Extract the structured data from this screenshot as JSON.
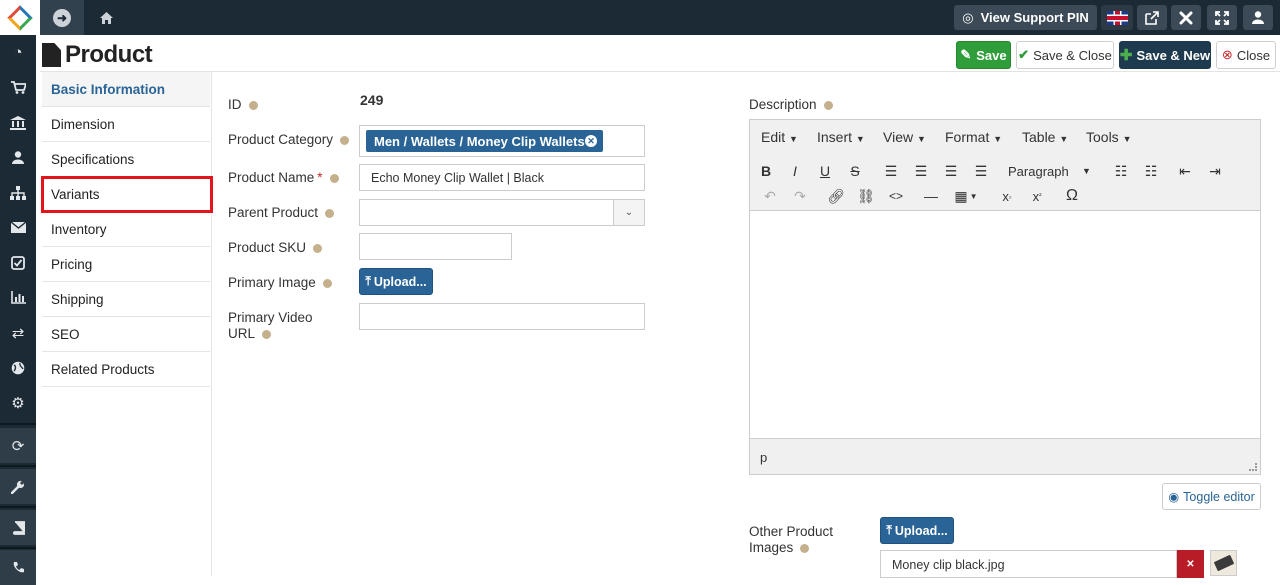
{
  "topbar": {
    "support_label": "View Support PIN"
  },
  "header": {
    "title": "Product",
    "save": "Save",
    "save_close": "Save & Close",
    "save_new": "Save & New",
    "close": "Close"
  },
  "tabs": [
    "Basic Information",
    "Dimension",
    "Specifications",
    "Variants",
    "Inventory",
    "Pricing",
    "Shipping",
    "SEO",
    "Related Products"
  ],
  "form": {
    "id_label": "ID",
    "id_value": "249",
    "category_label": "Product Category",
    "category_tag": "Men / Wallets / Money Clip Wallets",
    "name_label": "Product Name",
    "name_required": "*",
    "name_value": "Echo Money Clip Wallet | Black",
    "parent_label": "Parent Product",
    "sku_label": "Product SKU",
    "image_label": "Primary Image",
    "upload_label": "Upload...",
    "video_label_1": "Primary Video",
    "video_label_2": "URL",
    "description_label": "Description",
    "other_images_label_1": "Other Product",
    "other_images_label_2": "Images",
    "other_upload_label": "Upload...",
    "file_name": "Money clip black.jpg",
    "toggle_editor": "Toggle editor"
  },
  "editor": {
    "menus": [
      "Edit",
      "Insert",
      "View",
      "Format",
      "Table",
      "Tools"
    ],
    "paragraph": "Paragraph",
    "status_path": "p"
  },
  "colors": {
    "topbar": "#1c2a35",
    "primary": "#2a6496",
    "save_green": "#2f9d3a",
    "highlight_red": "#e3141b"
  }
}
